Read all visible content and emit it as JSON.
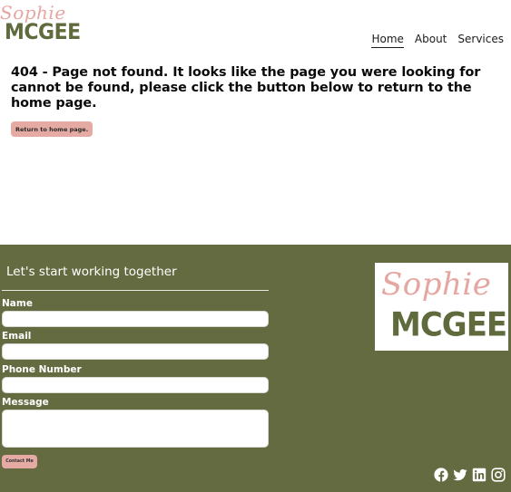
{
  "header": {
    "logo": {
      "script_text": "Sophie",
      "block_text": "MCGEE"
    },
    "nav": [
      {
        "label": "Home",
        "active": true
      },
      {
        "label": "About",
        "active": false
      },
      {
        "label": "Services",
        "active": false
      }
    ]
  },
  "main": {
    "heading": "404 - Page not found. It looks like the page you were looking for cannot be found, please click the button below to return to the home page.",
    "button_label": "Return to home page."
  },
  "footer": {
    "title": "Let's start working together",
    "form": {
      "name_label": "Name",
      "email_label": "Email",
      "phone_label": "Phone Number",
      "message_label": "Message",
      "submit_label": "Contact Me"
    },
    "logo": {
      "script_text": "Sophie",
      "block_text": "MCGEE"
    },
    "socials": [
      "facebook-icon",
      "twitter-icon",
      "linkedin-icon",
      "instagram-icon"
    ]
  },
  "colors": {
    "brand_pink": "#e6a6a1",
    "brand_olive": "#5f6b3d",
    "footer_bg": "#656b40"
  }
}
